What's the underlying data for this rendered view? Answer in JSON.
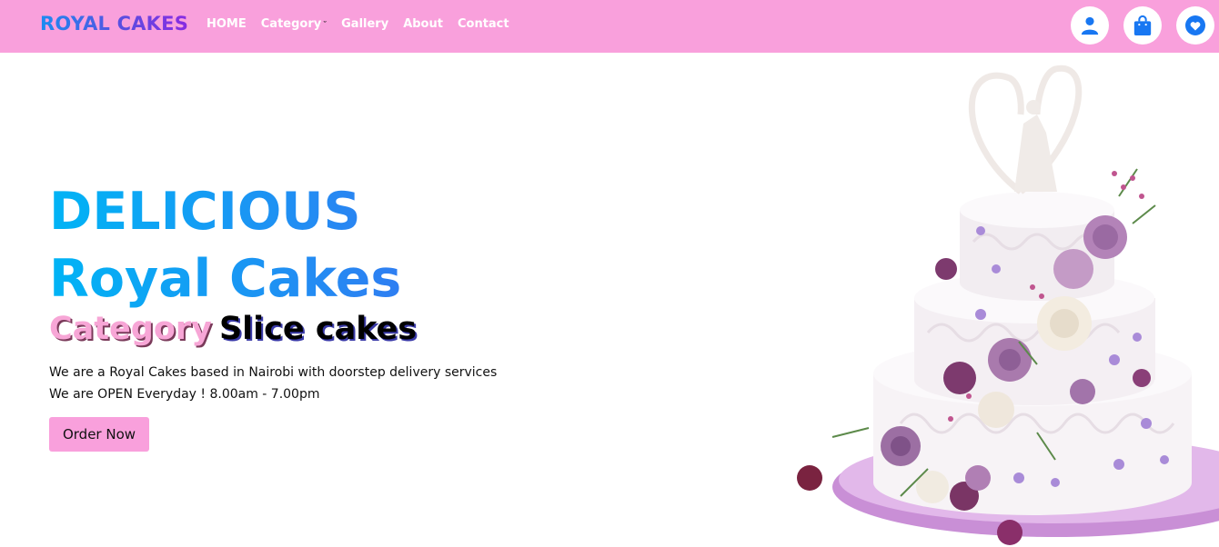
{
  "nav": {
    "brand": "ROYAL CAKES",
    "links": [
      "HOME",
      "Category",
      "Gallery",
      "About",
      "Contact"
    ],
    "icons": [
      "user-icon",
      "shopping-bag-icon",
      "heart-icon"
    ]
  },
  "hero": {
    "title_line1": "DELICIOUS",
    "title_line2": "Royal Cakes",
    "category_label": "Category",
    "category_value": "Slice cakes",
    "description_line1": "We are a Royal Cakes based in Nairobi with doorstep delivery services",
    "description_line2": "We are OPEN Everyday ! 8.00am - 7.00pm",
    "button": "Order Now"
  },
  "colors": {
    "navbar": "#f9a0dc",
    "icon_blue": "#1877f2",
    "title_gradient_start": "#00b4f5",
    "title_gradient_end": "#2f7ef2"
  }
}
